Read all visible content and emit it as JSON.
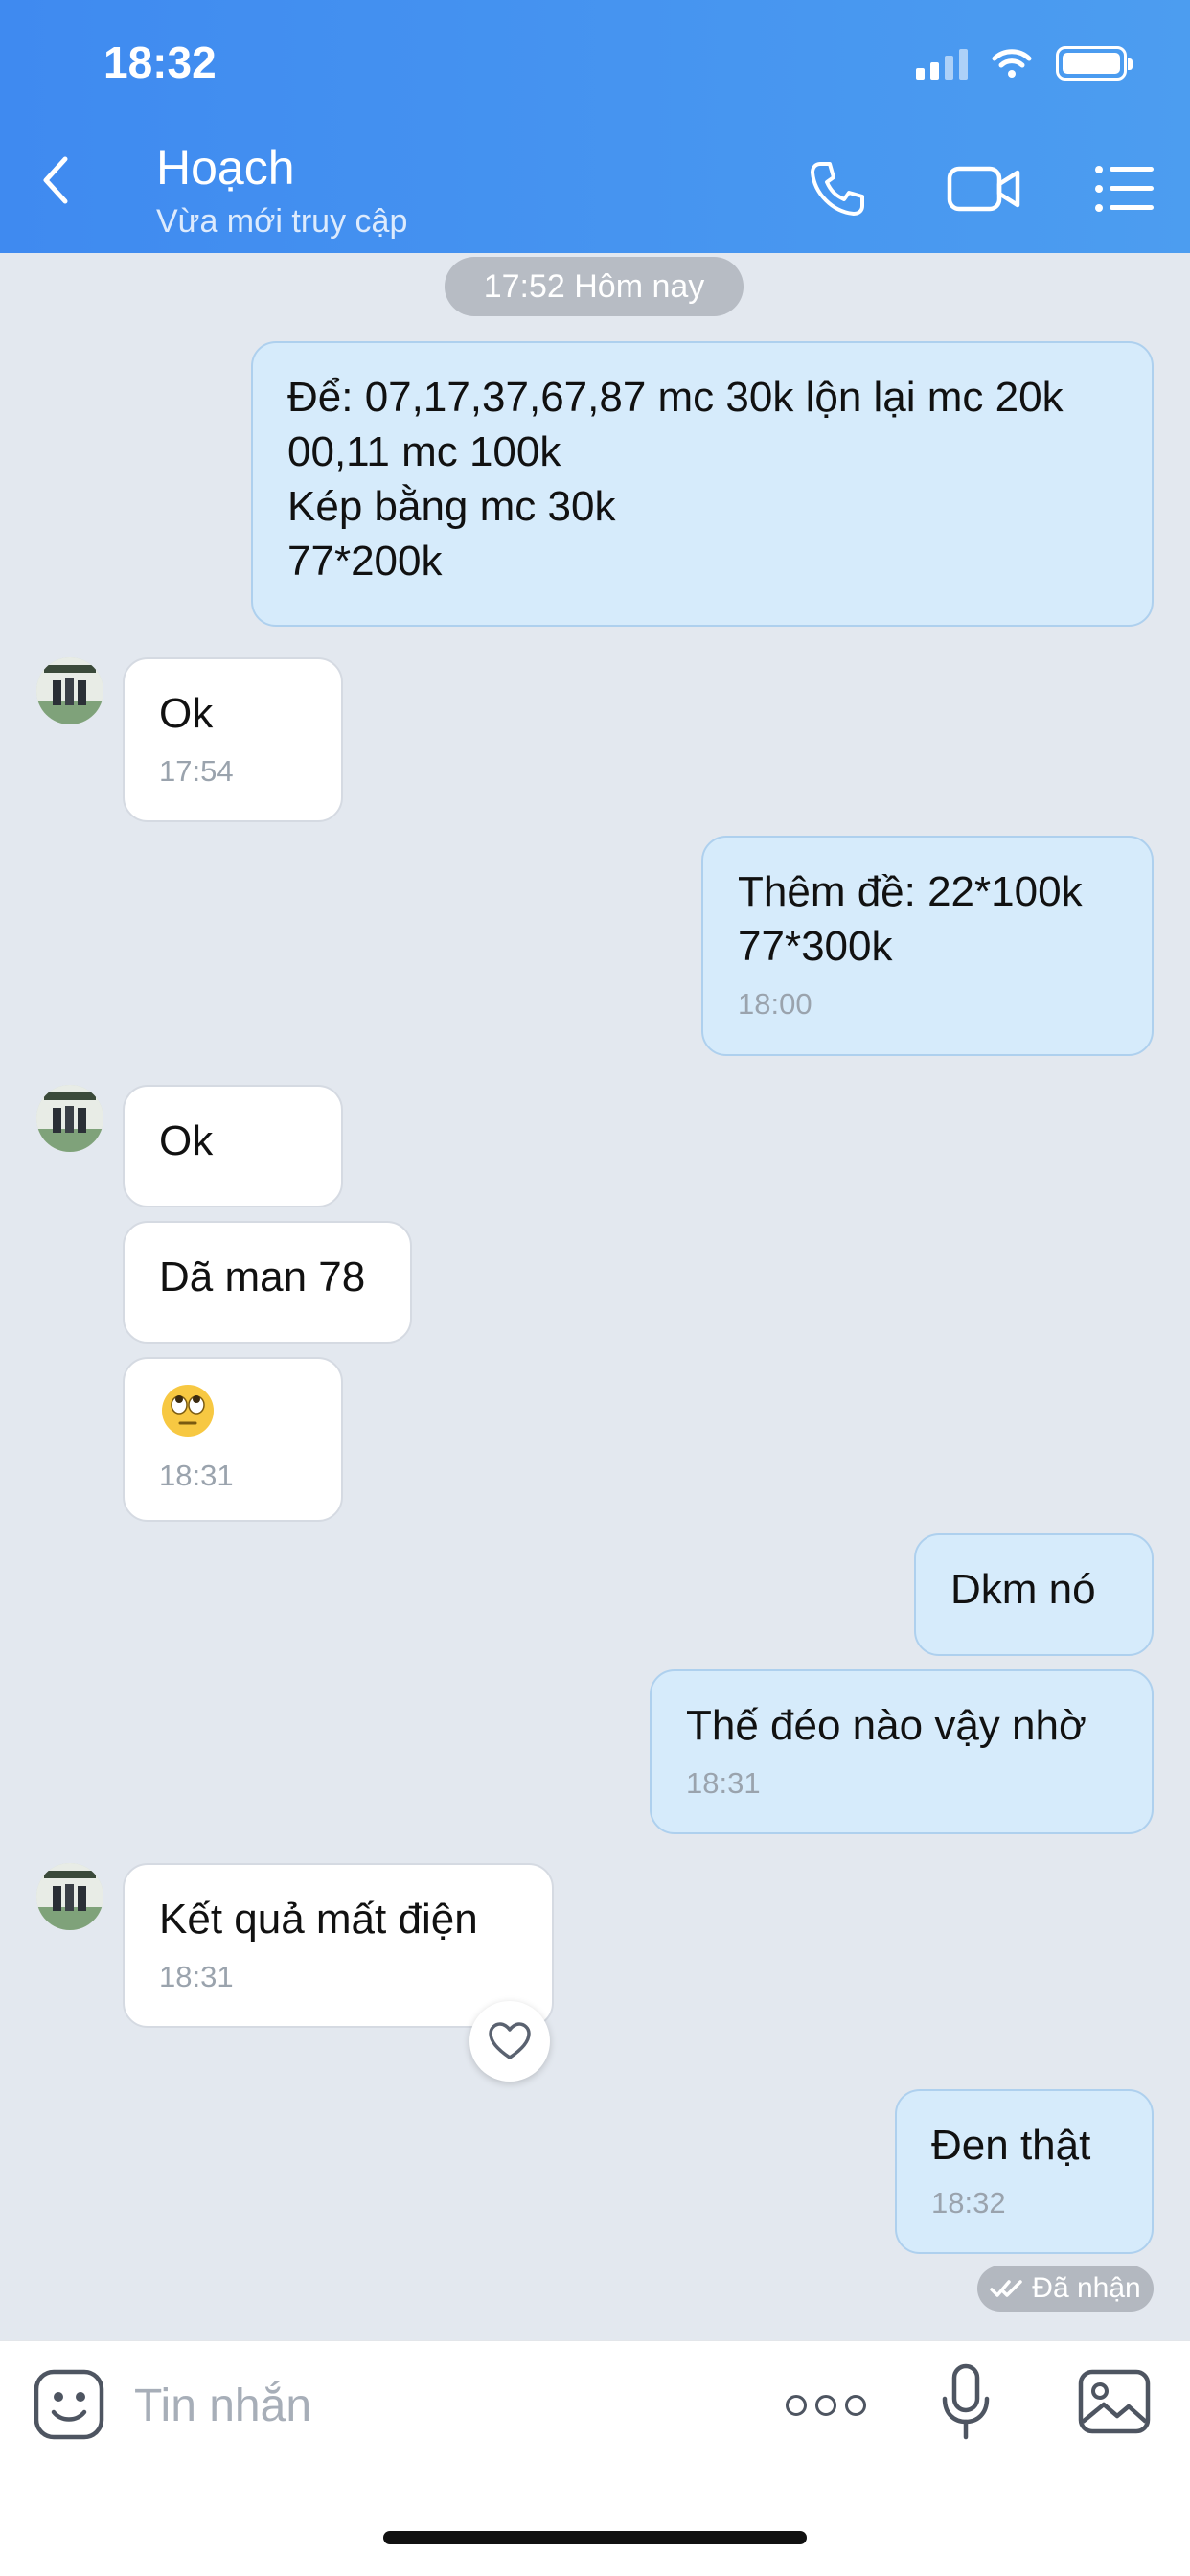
{
  "status_bar": {
    "time": "18:32"
  },
  "header": {
    "contact_name": "Hoạch",
    "contact_status": "Vừa mới truy cập",
    "icons": [
      "back-icon",
      "phone-icon",
      "video-camera-icon",
      "menu-list-icon"
    ]
  },
  "date_separator": "17:52 Hôm nay",
  "messages": [
    {
      "dir": "out",
      "lines": [
        "Để: 07,17,37,67,87 mc 30k lộn lại mc 20k",
        "00,11 mc 100k",
        "Kép bằng mc 30k",
        "77*200k"
      ],
      "time": ""
    },
    {
      "dir": "in",
      "lines": [
        "Ok"
      ],
      "time": "17:54"
    },
    {
      "dir": "out",
      "lines": [
        "Thêm đề: 22*100k",
        "77*300k"
      ],
      "time": "18:00"
    },
    {
      "dir": "in",
      "lines": [
        "Ok"
      ],
      "time": ""
    },
    {
      "dir": "in",
      "lines": [
        "Dã man 78"
      ],
      "time": ""
    },
    {
      "dir": "in",
      "lines": [],
      "emoji": "eye-roll-emoji",
      "time": "18:31"
    },
    {
      "dir": "out",
      "lines": [
        "Dkm nó"
      ],
      "time": ""
    },
    {
      "dir": "out",
      "lines": [
        "Thế đéo nào vậy nhờ"
      ],
      "time": "18:31"
    },
    {
      "dir": "in",
      "lines": [
        "Kết quả mất điện"
      ],
      "time": "18:31"
    },
    {
      "dir": "out",
      "lines": [
        "Đen thật"
      ],
      "time": "18:32"
    }
  ],
  "receipt": "Đã nhận",
  "input_bar": {
    "placeholder": "Tin nhắn",
    "icons": [
      "sticker-icon",
      "more-icon",
      "microphone-icon",
      "image-icon"
    ]
  },
  "colors": {
    "header": "#3f8af0",
    "outgoing_bubble": "#d6ebfb",
    "incoming_bubble": "#ffffff",
    "background": "#e3e8ef"
  }
}
